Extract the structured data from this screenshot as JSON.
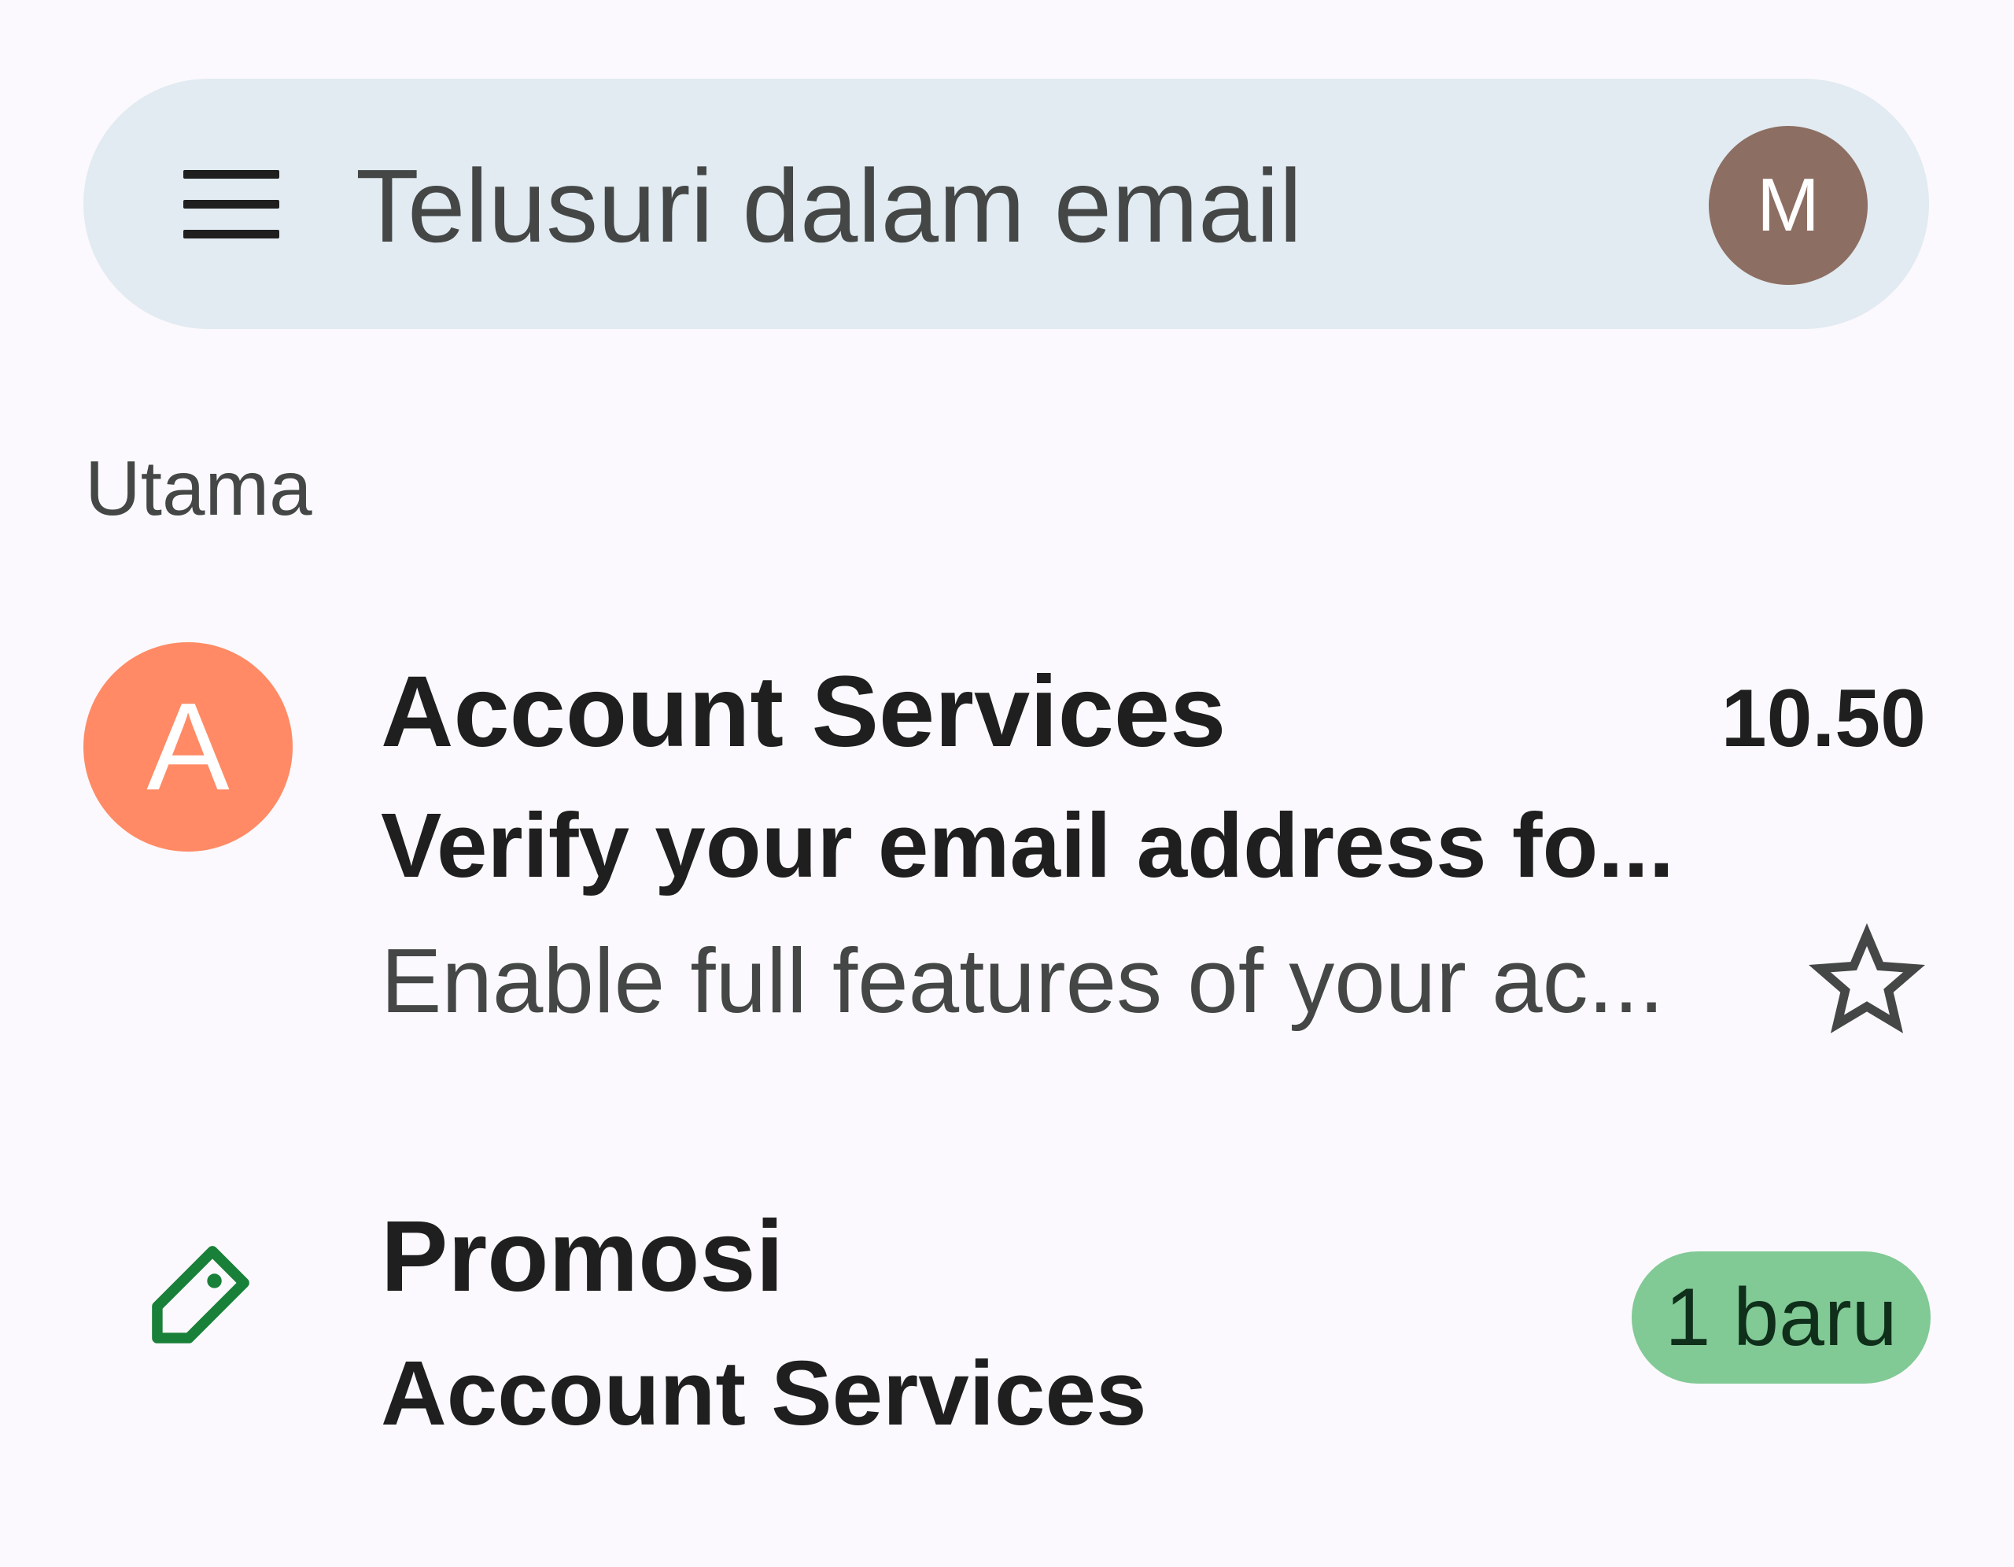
{
  "search": {
    "placeholder": "Telusuri dalam email",
    "menu_icon": "menu-icon",
    "account_initial": "M",
    "account_color": "#8d6e63"
  },
  "section": {
    "label": "Utama"
  },
  "email": {
    "avatar_initial": "A",
    "avatar_color": "#ff8a65",
    "sender": "Account Services",
    "time": "10.50",
    "subject": "Verify your email address fo...",
    "snippet": "Enable full features of your ac...",
    "star_icon": "star-outline-icon"
  },
  "promotions": {
    "icon": "tag-icon",
    "title": "Promosi",
    "sender": "Account Services",
    "badge": "1 baru",
    "badge_color": "#81c995",
    "icon_color": "#188038"
  }
}
